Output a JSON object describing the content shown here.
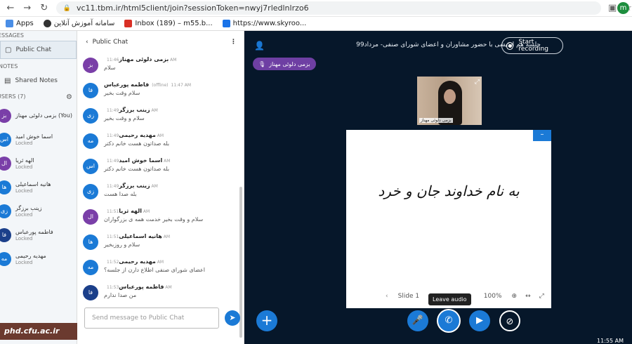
{
  "browser": {
    "url": "vc11.tbm.ir/html5client/join?sessionToken=nwyj7rledlnlrzo6",
    "profile_initial": "m"
  },
  "bookmarks": [
    {
      "label": "Apps",
      "color": "#4a8ee6"
    },
    {
      "label": "سامانه آموزش آنلاین",
      "color": "#333"
    },
    {
      "label": "Inbox (189) – m55.b...",
      "color": "#d93025"
    },
    {
      "label": "https://www.skyroo...",
      "color": "#1a73e8"
    }
  ],
  "left": {
    "messages_header": "MESSAGES",
    "public_chat": "Public Chat",
    "notes_header": "NOTES",
    "shared_notes": "Shared Notes",
    "users_header": "USERS (7)"
  },
  "users": [
    {
      "initials": "بز",
      "name": "بزمی دلوئی مهناز (You)",
      "status": "",
      "color": "#7a3fa8"
    },
    {
      "initials": "اس",
      "name": "اسما خوش امید",
      "status": "Locked",
      "color": "#1b7ad6"
    },
    {
      "initials": "ال",
      "name": "الهه ثریا",
      "status": "Locked",
      "color": "#7a3fa8"
    },
    {
      "initials": "ها",
      "name": "هانیه اسماعیلی",
      "status": "Locked",
      "color": "#1b7ad6"
    },
    {
      "initials": "زی",
      "name": "زینب برزگر",
      "status": "Locked",
      "color": "#1b7ad6"
    },
    {
      "initials": "فا",
      "name": "فاطمه پورعباس",
      "status": "Locked",
      "color": "#1b3f8a"
    },
    {
      "initials": "مه",
      "name": "مهدیه رحیمی",
      "status": "Locked",
      "color": "#1b7ad6"
    }
  ],
  "chat": {
    "title": "Public Chat",
    "input_placeholder": "Send message to Public Chat"
  },
  "messages": [
    {
      "initials": "بز",
      "sender": "بزمی دلوئی مهناز",
      "time": "11:46 AM",
      "text": "سلام",
      "color": "#7a3fa8"
    },
    {
      "initials": "فا",
      "sender": "فاطمه پورعباس",
      "offline": "(offline)",
      "time": "11:47 AM",
      "text": "سلام وقت بخیر",
      "color": "#1b7ad6"
    },
    {
      "initials": "زی",
      "sender": "زینب برزگر",
      "time": "11:49 AM",
      "text": "سلام و وقت بخیر",
      "color": "#1b7ad6"
    },
    {
      "initials": "مه",
      "sender": "مهدیه رحیمی",
      "time": "11:49 AM",
      "text": "بله صداتون هست خانم دکتر",
      "color": "#1b7ad6"
    },
    {
      "initials": "اس",
      "sender": "اسما خوش امید",
      "time": "11:49 AM",
      "text": "بله صداتون هست خانم دکتر",
      "color": "#1b7ad6"
    },
    {
      "initials": "زی",
      "sender": "زینب برزگر",
      "time": "11:49 AM",
      "text": "بله صدا هست",
      "color": "#1b7ad6"
    },
    {
      "initials": "ال",
      "sender": "الهه ثریا",
      "time": "11:51 AM",
      "text": "سلام و وقت بخیر خدمت همه ی بزرگواران",
      "color": "#7a3fa8"
    },
    {
      "initials": "ها",
      "sender": "هانیه اسماعیلی",
      "time": "11:51 AM",
      "text": "سلام و روزبخیر",
      "color": "#1b7ad6"
    },
    {
      "initials": "مه",
      "sender": "مهدیه رحیمی",
      "time": "11:52 AM",
      "text": "اعضای شورای صنفی اطلاع دارن از جلسه؟",
      "color": "#1b7ad6"
    },
    {
      "initials": "فا",
      "sender": "فاطمه پورعباس",
      "time": "11:53 AM",
      "text": "من صدا ندارم",
      "color": "#1b3f8a"
    }
  ],
  "stage": {
    "title": "جلسه هم اندیشی با حضور مشاوران و اعضای شورای صنفی- مرداد99",
    "record_label": "Start recording",
    "talking": "بزمی دلوئی مهناز",
    "webcam_name": "بزمی دلوئی مهناز"
  },
  "slide": {
    "text": "به نام خداوند جان و خرد",
    "slide_label": "Slide 1",
    "zoom": "100%"
  },
  "controls": {
    "leave_audio_tooltip": "Leave audio"
  },
  "watermark": "phd.cfu.ac.ir",
  "clock": "11:55 AM",
  "colors": {
    "accent": "#1b7ad6",
    "stage_bg": "#06172a",
    "talking": "#6e3fa3"
  }
}
